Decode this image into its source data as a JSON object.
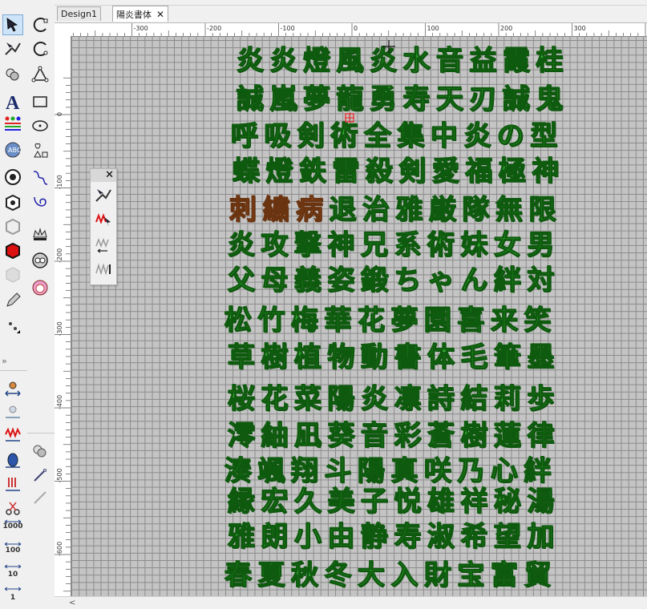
{
  "tabs": [
    {
      "label": "Design1",
      "active": false
    },
    {
      "label": "陽炎書体",
      "active": true
    }
  ],
  "ruler_top_labels": [
    "-300",
    "-200",
    "-100",
    "0",
    "100",
    "200",
    "300"
  ],
  "ruler_left_labels": [
    "0",
    "-100",
    "-200",
    "-300",
    "-400",
    "-500",
    "-600"
  ],
  "left_toolbar": {
    "number_buttons": [
      "1000",
      "100",
      "10",
      "1"
    ]
  },
  "glyph_rows": [
    {
      "chars": [
        "炎",
        "炎",
        "燈",
        "風",
        "炎",
        "水",
        "音",
        "益",
        "霞",
        "桂"
      ]
    },
    {
      "chars": [
        "誠",
        "嵐",
        "夢",
        "龍",
        "勇",
        "寿",
        "天",
        "刃",
        "誠",
        "鬼"
      ]
    },
    {
      "chars": [
        "呼",
        "吸",
        "剣",
        "術",
        "全",
        "集",
        "中",
        "炎",
        "の",
        "型"
      ]
    },
    {
      "chars": [
        "蝶",
        "燈",
        "鉄",
        "雷",
        "殺",
        "剣",
        "愛",
        "福",
        "極",
        "神"
      ]
    },
    {
      "chars": [
        "刺",
        "繍",
        "病",
        "退",
        "治",
        "雅",
        "厳",
        "隊",
        "無",
        "限"
      ]
    },
    {
      "chars": [
        "炎",
        "攻",
        "撃",
        "神",
        "兄",
        "系",
        "術",
        "妹",
        "女",
        "男"
      ]
    },
    {
      "chars": [
        "父",
        "母",
        "義",
        "姿",
        "鍛",
        "ち",
        "ゃ",
        "ん",
        "絆",
        "対"
      ]
    },
    {
      "chars": [
        "松",
        "竹",
        "梅",
        "華",
        "花",
        "夢",
        "園",
        "喜",
        "来",
        "笑"
      ]
    },
    {
      "chars": [
        "草",
        "樹",
        "植",
        "物",
        "動",
        "書",
        "体",
        "毛",
        "筆",
        "墨"
      ]
    },
    {
      "chars": [
        "桜",
        "花",
        "菜",
        "陽",
        "炎",
        "凛",
        "詩",
        "結",
        "莉",
        "歩"
      ]
    },
    {
      "chars": [
        "澪",
        "紬",
        "凪",
        "葵",
        "音",
        "彩",
        "蒼",
        "樹",
        "蓮",
        "律"
      ]
    },
    {
      "chars": [
        "湊",
        "颯",
        "翔",
        "斗",
        "陽",
        "真",
        "咲",
        "乃",
        "心",
        "絆"
      ]
    },
    {
      "chars": [
        "縁",
        "宏",
        "久",
        "美",
        "子",
        "悦",
        "雄",
        "祥",
        "秘",
        "湯"
      ]
    },
    {
      "chars": [
        "雅",
        "朗",
        "小",
        "由",
        "静",
        "寿",
        "淑",
        "希",
        "望",
        "加"
      ]
    },
    {
      "chars": [
        "春",
        "夏",
        "秋",
        "冬",
        "大",
        "入",
        "財",
        "宝",
        "富",
        "貿"
      ]
    }
  ],
  "highlighted_row": 4,
  "highlighted_count": 3,
  "colors": {
    "glyph_green": "#32a832",
    "glyph_outline": "#0e5a0e",
    "glyph_selected": "#b86a38",
    "grid": "#8a8a8a",
    "canvas": "#c4c4c4"
  }
}
